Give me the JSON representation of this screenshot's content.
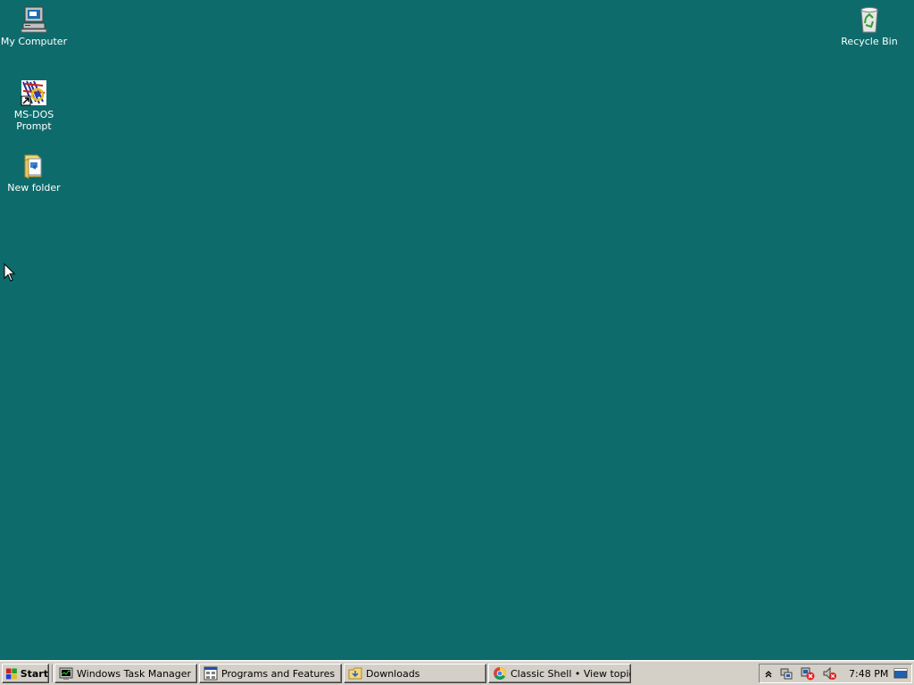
{
  "desktop": {
    "background_color": "#0e6b6b",
    "icons": {
      "my_computer": {
        "label": "My Computer",
        "icon": "my-computer-icon"
      },
      "msdos": {
        "label": "MS-DOS\nPrompt",
        "icon": "msdos-prompt-icon"
      },
      "new_folder": {
        "label": "New folder",
        "icon": "folder-icon"
      },
      "recycle_bin": {
        "label": "Recycle Bin",
        "icon": "recycle-bin-icon"
      }
    }
  },
  "taskbar": {
    "start_label": "Start",
    "tasks": [
      {
        "label": "Windows Task Manager",
        "icon": "task-manager-icon"
      },
      {
        "label": "Programs and Features",
        "icon": "programs-features-icon"
      },
      {
        "label": "Downloads",
        "icon": "folder-icon"
      },
      {
        "label": "Classic Shell • View topic ...",
        "icon": "chrome-icon"
      }
    ],
    "tray": {
      "clock": "7:48 PM",
      "icons": [
        "show-hidden-icons-icon",
        "network-icon",
        "network-disconnected-icon",
        "volume-muted-icon",
        "show-desktop-icon"
      ]
    }
  }
}
